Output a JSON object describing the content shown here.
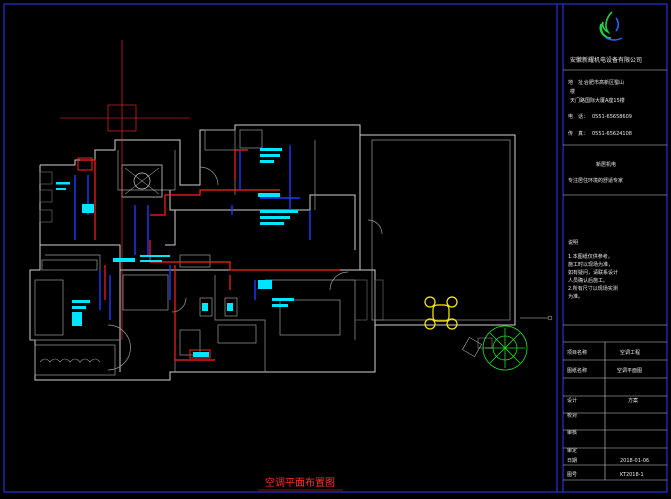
{
  "titleblock": {
    "company": "安徽新耀机电设备有限公司",
    "address_label": "地　址：",
    "address_line1": "合肥市高新区蜀山",
    "address_line2": "楼",
    "address_line3": "天门路国际大厦A座15楼",
    "phone_label": "电　话：",
    "phone": "0551-65658609",
    "fax_label": "传　真：",
    "fax": "0551-65624108",
    "slogan1": "新居机电",
    "slogan2": "专注居住环境的舒适专家",
    "notes_heading": "说明",
    "notes": [
      "1.本图纸仅供参考，",
      "施工时以现场为准，",
      "如有疑问，请联系设计",
      "人员确认后施工。",
      "2.所有尺寸以现场实测",
      "为准。"
    ],
    "row_project_label": "项目名称",
    "row_project_value": "空调工程",
    "row_drawing_label": "图纸名称",
    "row_drawing_value": "空调平面图",
    "row_design_label": "设计",
    "row_design_value": "方案",
    "row_check_label": "校对",
    "row_check_value": "",
    "row_review_label": "审核",
    "row_approve_label": "审定",
    "row_date_label": "日期",
    "row_date_value": "2018-01-06",
    "row_no_label": "图号",
    "row_no_value": "KT2018-1"
  },
  "plan": {
    "title": "空调平面布置图"
  },
  "colors": {
    "background": "#000000",
    "walls": "#cfcfcf",
    "refrigerant_pipe": "#ff2020",
    "condensate_pipe": "#1a3cff",
    "indoor_unit": "#00e5ff",
    "furniture": "#ffee00",
    "tree": "#22dd22",
    "frame": "#2a3cff"
  }
}
